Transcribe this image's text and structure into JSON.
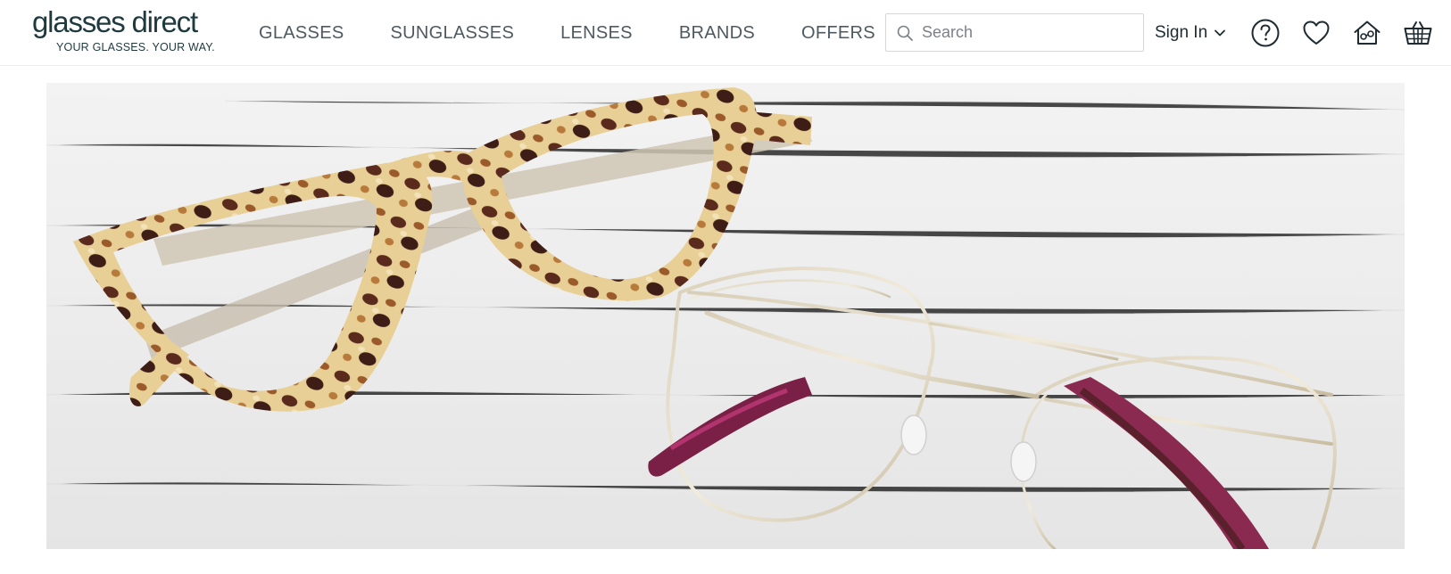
{
  "brand": {
    "name": "glasses direct",
    "tagline": "YOUR GLASSES. YOUR WAY."
  },
  "nav": {
    "items": [
      {
        "label": "GLASSES"
      },
      {
        "label": "SUNGLASSES"
      },
      {
        "label": "LENSES"
      },
      {
        "label": "BRANDS"
      },
      {
        "label": "OFFERS"
      }
    ]
  },
  "search": {
    "placeholder": "Search",
    "value": ""
  },
  "account": {
    "signin_label": "Sign In"
  },
  "icons": [
    "search-icon",
    "chevron-down-icon",
    "help-icon",
    "heart-icon",
    "home-try-on-icon",
    "basket-icon"
  ],
  "colors": {
    "text": "#1e2b32",
    "nav_text": "#4e5a60",
    "logo": "#1e3a3f"
  }
}
